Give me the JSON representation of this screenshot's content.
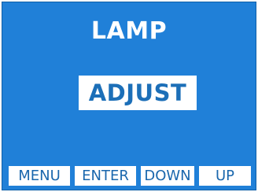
{
  "display": {
    "title": "LAMP",
    "selected_option": "ADJUST",
    "softkeys": [
      {
        "label": "MENU"
      },
      {
        "label": "ENTER"
      },
      {
        "label": "DOWN"
      },
      {
        "label": "UP"
      }
    ]
  },
  "colors": {
    "screen_background": "#2080d8",
    "highlight_background": "#ffffff",
    "highlight_text": "#1c6fb8",
    "title_text": "#ffffff",
    "softkey_background": "#ffffff",
    "softkey_text": "#1a67ad"
  }
}
